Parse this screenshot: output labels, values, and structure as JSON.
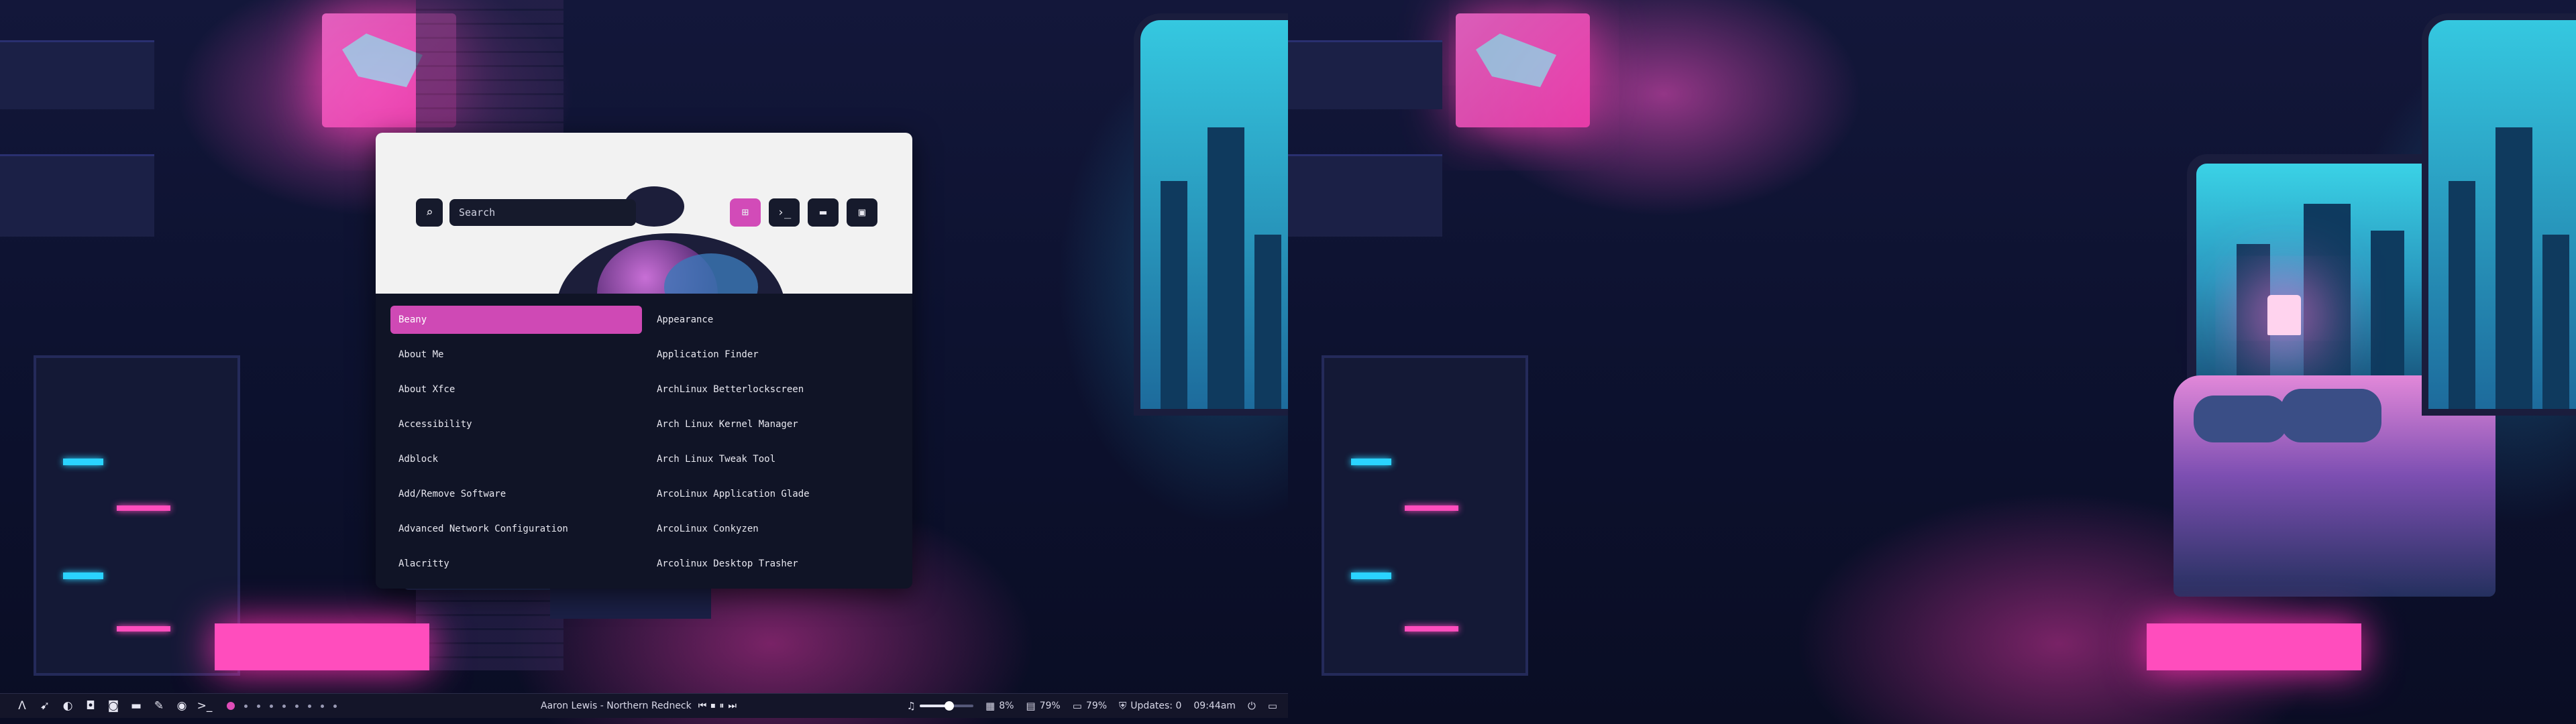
{
  "launcher": {
    "search_placeholder": "Search",
    "search_icon": "magnifier-icon",
    "modes": [
      {
        "name": "apps-grid-icon",
        "glyph": "⊞",
        "active": true
      },
      {
        "name": "terminal-icon",
        "glyph": "›_",
        "active": false
      },
      {
        "name": "folder-icon",
        "glyph": "▬",
        "active": false
      },
      {
        "name": "window-icon",
        "glyph": "▣",
        "active": false
      }
    ],
    "apps_left": [
      "Beany",
      "About Me",
      "About Xfce",
      "Accessibility",
      "Adblock",
      "Add/Remove Software",
      "Advanced Network Configuration",
      "Alacritty"
    ],
    "apps_right": [
      "Appearance",
      "Application Finder",
      "ArchLinux Betterlockscreen",
      "Arch Linux Kernel Manager",
      "Arch Linux Tweak Tool",
      "ArcoLinux Application Glade",
      "ArcoLinux Conkyzen",
      "Arcolinux Desktop Trasher"
    ],
    "selected": "Beany"
  },
  "panel": {
    "launchers": [
      {
        "name": "arch-logo-icon",
        "glyph": "Λ"
      },
      {
        "name": "rocket-icon",
        "glyph": "➹"
      },
      {
        "name": "half-circle-icon",
        "glyph": "◐"
      },
      {
        "name": "gamepad-icon",
        "glyph": "◘"
      },
      {
        "name": "shopping-bag-icon",
        "glyph": "◙"
      },
      {
        "name": "folder-icon",
        "glyph": "▬"
      },
      {
        "name": "wrench-icon",
        "glyph": "✎"
      },
      {
        "name": "camera-icon",
        "glyph": "◉"
      },
      {
        "name": "terminal-icon",
        "glyph": ">_"
      }
    ],
    "workspaces_count": 9,
    "active_workspace": 1,
    "now_playing": "Aaron Lewis - Northern Redneck",
    "media_controls": [
      "⏮",
      "⏹",
      "⏸",
      "⏭"
    ],
    "volume_icon": "music-note-icon",
    "volume_level": 0.55,
    "cpu": "8%",
    "memory": "79%",
    "disk": "79%",
    "updates": "Updates: 0",
    "time": "09:44am",
    "power_icon": "power-icon",
    "display_icon": "monitor-icon"
  },
  "colors": {
    "accent": "#cf49b5",
    "panel_bg": "#141529",
    "launcher_bg": "#101426",
    "header_bg": "#f2f2f2"
  }
}
